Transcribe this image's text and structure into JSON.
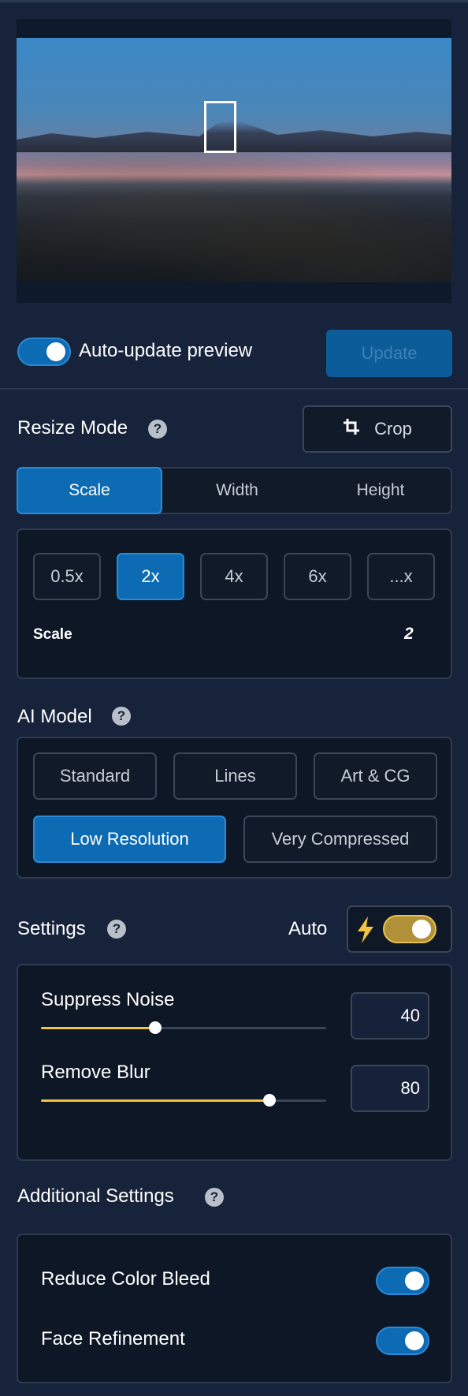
{
  "preview": {
    "auto_update_label": "Auto-update preview",
    "update_label": "Update",
    "auto_update_on": true
  },
  "resize": {
    "title": "Resize Mode",
    "crop_label": "Crop",
    "modes": [
      "Scale",
      "Width",
      "Height"
    ],
    "active_mode": "Scale",
    "presets": [
      "0.5x",
      "2x",
      "4x",
      "6x",
      "...x"
    ],
    "active_preset": "2x",
    "scale_label": "Scale",
    "scale_value": "2"
  },
  "ai_model": {
    "title": "AI Model",
    "models_row1": [
      "Standard",
      "Lines",
      "Art & CG"
    ],
    "models_row2": [
      "Low Resolution",
      "Very Compressed"
    ],
    "active_model": "Low Resolution"
  },
  "settings": {
    "title": "Settings",
    "auto_label": "Auto",
    "auto_on": true,
    "sliders": [
      {
        "label": "Suppress Noise",
        "value": "40",
        "level": 40
      },
      {
        "label": "Remove Blur",
        "value": "80",
        "level": 80
      }
    ]
  },
  "additional": {
    "title": "Additional Settings",
    "toggles": [
      {
        "label": "Reduce Color Bleed",
        "on": true
      },
      {
        "label": "Face Refinement",
        "on": true
      }
    ]
  },
  "colors": {
    "background": "#16233a",
    "accent": "#0d6bb3",
    "slider": "#f2c33f"
  }
}
